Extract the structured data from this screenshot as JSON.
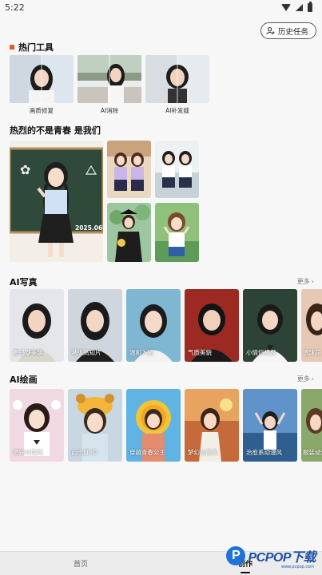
{
  "status": {
    "time": "5:22"
  },
  "history_button": {
    "label": "历史任务"
  },
  "hot_tools": {
    "title": "热门工具",
    "items": [
      {
        "label": "画质修复"
      },
      {
        "label": "AI消除"
      },
      {
        "label": "AI补发缝"
      }
    ]
  },
  "youth": {
    "title": "热烈的不是青春 是我们",
    "chalkboard_date": "2025.06"
  },
  "ai_portrait": {
    "title": "AI写真",
    "more": "更多",
    "items": [
      {
        "label": "恩感潮美朝"
      },
      {
        "label": "港版高知片"
      },
      {
        "label": "温和入镜"
      },
      {
        "label": "气质美貌"
      },
      {
        "label": "小情侣视频"
      },
      {
        "label": "透球花"
      }
    ]
  },
  "ai_drawing": {
    "title": "AI绘画",
    "more": "更多",
    "items": [
      {
        "label": "嗯好时雨网"
      },
      {
        "label": "芭比真3D"
      },
      {
        "label": "穿越青春公主"
      },
      {
        "label": "梦幻油画风"
      },
      {
        "label": "治愈系动漫风"
      },
      {
        "label": "服装动漫"
      }
    ]
  },
  "tabbar": {
    "tabs": [
      {
        "label": "首页"
      },
      {
        "label": "创作"
      }
    ]
  },
  "watermark": {
    "text": "PCPOP下载",
    "letter": "P",
    "sub": "www.pcpop.com"
  },
  "colors": {
    "accent": "#e4572e",
    "brand_blue": "#1e73d8"
  }
}
